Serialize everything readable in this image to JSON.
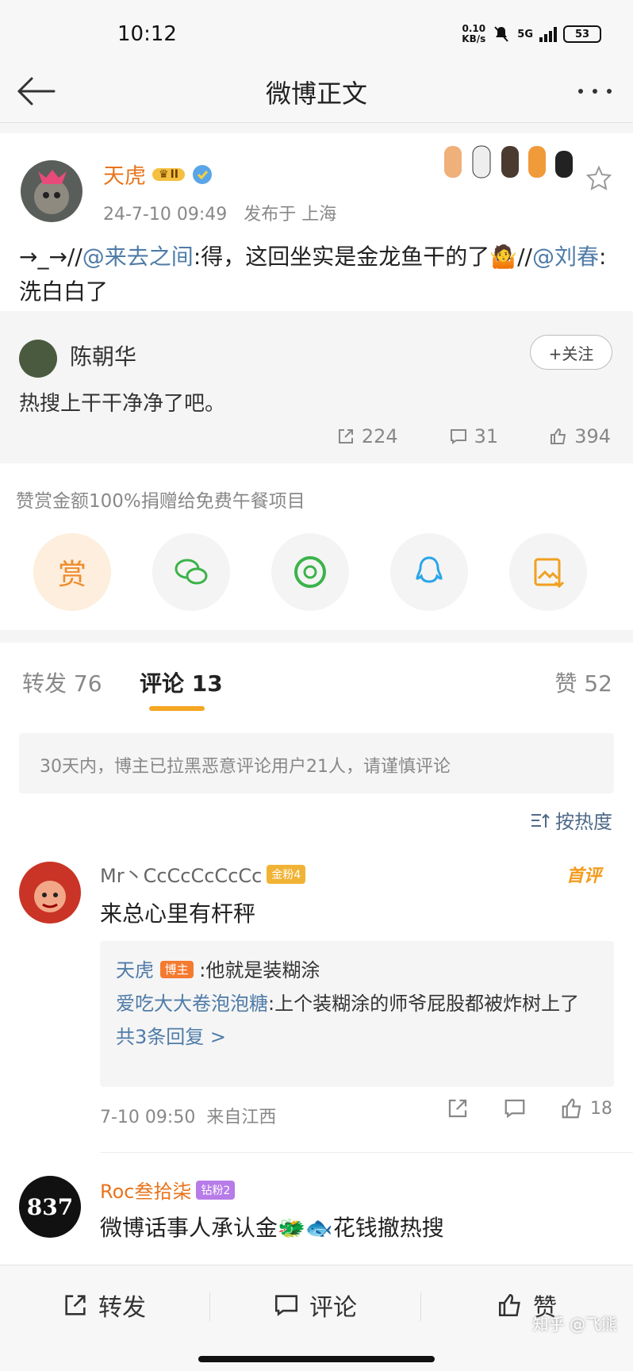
{
  "status_bar": {
    "time": "10:12",
    "net_speed_value": "0.10",
    "net_speed_unit": "KB/s",
    "network": "5G",
    "battery": "53"
  },
  "nav": {
    "title": "微博正文"
  },
  "post": {
    "username": "天虎",
    "level_badge": "II",
    "timestamp": "24-7-10 09:49",
    "location": "发布于 上海",
    "text_prefix": "→_→//",
    "mention1": "@来去之间",
    "text_mid": ":得，这回坐实是金龙鱼干的了🤷//",
    "mention2": "@刘春",
    "text_suffix": ":洗白白了"
  },
  "repost": {
    "username": "陈朝华",
    "follow_label": "+关注",
    "text": "热搜上干干净净了吧。",
    "reposts": "224",
    "comments": "31",
    "likes": "394"
  },
  "reward": {
    "title": "赞赏金额100%捐赠给免费午餐项目",
    "reward_label": "赏",
    "share_targets": [
      "wechat-icon",
      "moments-icon",
      "qq-icon",
      "save-image-icon"
    ]
  },
  "tabs": {
    "repost_label": "转发",
    "repost_count": "76",
    "comment_label": "评论",
    "comment_count": "13",
    "like_label": "赞",
    "like_count": "52"
  },
  "comments": {
    "notice": "30天内，博主已拉黑恶意评论用户21人，请谨慎评论",
    "sort_label": "按热度",
    "items": [
      {
        "username": "Mr丶CcCcCcCcCc",
        "badge": "金粉4",
        "tag": "首评",
        "text": "来总心里有杆秤",
        "replies": [
          {
            "user": "天虎",
            "host_tag": "博主",
            "text": ":他就是装糊涂"
          },
          {
            "user": "爱吃大大卷泡泡糖",
            "text": ":上个装糊涂的师爷屁股都被炸树上了"
          }
        ],
        "more_replies": "共3条回复 >",
        "time": "7-10 09:50",
        "source": "来自江西",
        "likes": "18"
      },
      {
        "username": "Roc叁拾柒",
        "badge": "钻粉2",
        "avatar_text": "837",
        "text": "微博话事人承认金🐲🐟花钱撤热搜"
      }
    ]
  },
  "bottom_bar": {
    "repost": "转发",
    "comment": "评论",
    "like": "赞",
    "watermark": "知乎 @飞熊"
  },
  "colors": {
    "accent_orange": "#e8741c",
    "link_blue": "#4f7ca8",
    "tab_underline": "#f5a623"
  }
}
